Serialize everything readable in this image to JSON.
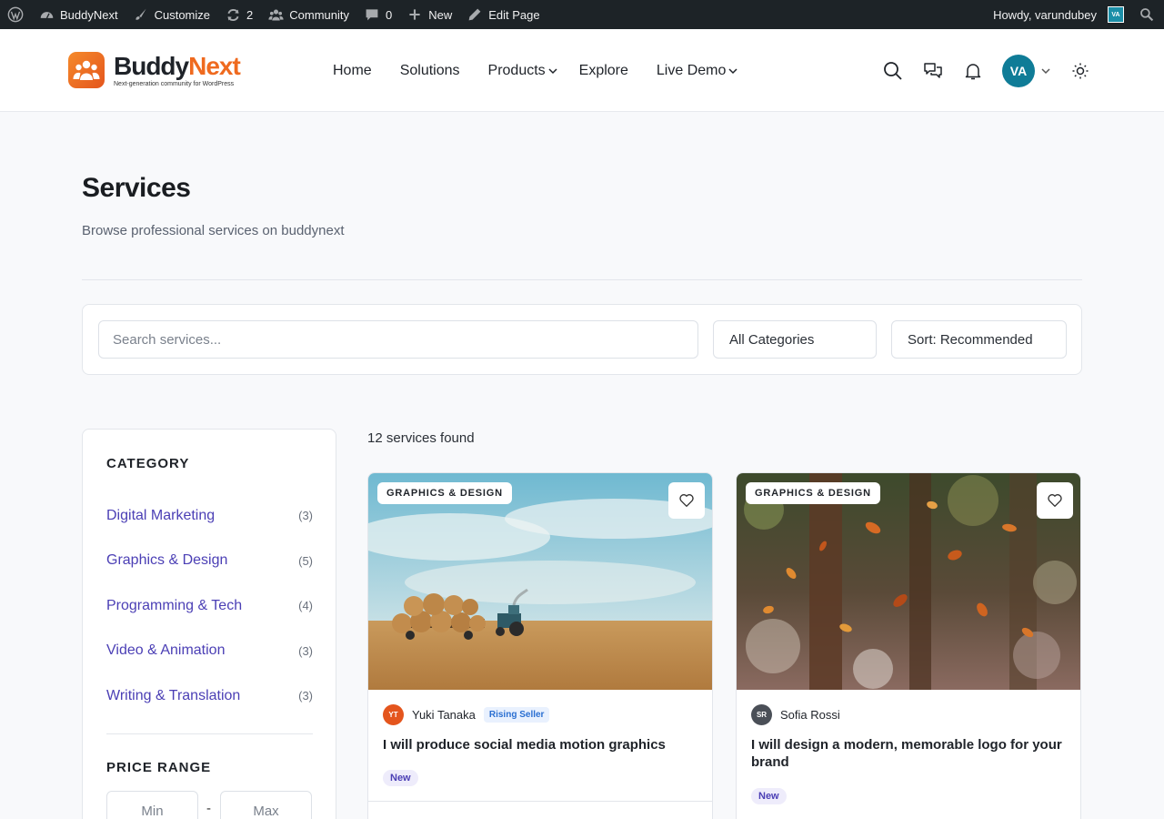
{
  "admin_bar": {
    "site_name": "BuddyNext",
    "customize": "Customize",
    "updates_count": "2",
    "community": "Community",
    "comments_count": "0",
    "new": "New",
    "edit_page": "Edit Page",
    "howdy": "Howdy, varundubey",
    "avatar_initials": "VA"
  },
  "header": {
    "logo_name_part1": "Buddy",
    "logo_name_part2": "Next",
    "logo_tagline": "Next-generation community for WordPress",
    "nav": [
      "Home",
      "Solutions",
      "Products",
      "Explore",
      "Live Demo"
    ],
    "user_initials": "VA"
  },
  "page": {
    "title": "Services",
    "subtitle": "Browse professional services on buddynext"
  },
  "filters": {
    "search_placeholder": "Search services...",
    "category_select": "All Categories",
    "sort_select": "Sort: Recommended"
  },
  "sidebar": {
    "category_heading": "CATEGORY",
    "categories": [
      {
        "name": "Digital Marketing",
        "count": "(3)"
      },
      {
        "name": "Graphics & Design",
        "count": "(5)"
      },
      {
        "name": "Programming & Tech",
        "count": "(4)"
      },
      {
        "name": "Video & Animation",
        "count": "(3)"
      },
      {
        "name": "Writing & Translation",
        "count": "(3)"
      }
    ],
    "price_heading": "PRICE RANGE",
    "min_placeholder": "Min",
    "max_placeholder": "Max",
    "dash": "-"
  },
  "results": {
    "count_text": "12 services found",
    "cards": [
      {
        "category": "GRAPHICS & DESIGN",
        "seller_initials": "YT",
        "seller_name": "Yuki Tanaka",
        "seller_badge": "Rising Seller",
        "title": "I will produce social media motion graphics",
        "tag": "New"
      },
      {
        "category": "GRAPHICS & DESIGN",
        "seller_initials": "SR",
        "seller_name": "Sofia Rossi",
        "title": "I will design a modern, memorable logo for your brand",
        "tag": "New"
      }
    ]
  },
  "colors": {
    "admin_bar_bg": "#1d2327",
    "brand_orange": "#ef6a1f",
    "link_purple": "#4b3fb5",
    "avatar_teal": "#0f7c97",
    "seller1_avatar": "#e4551d",
    "seller2_avatar": "#4a4f57"
  }
}
